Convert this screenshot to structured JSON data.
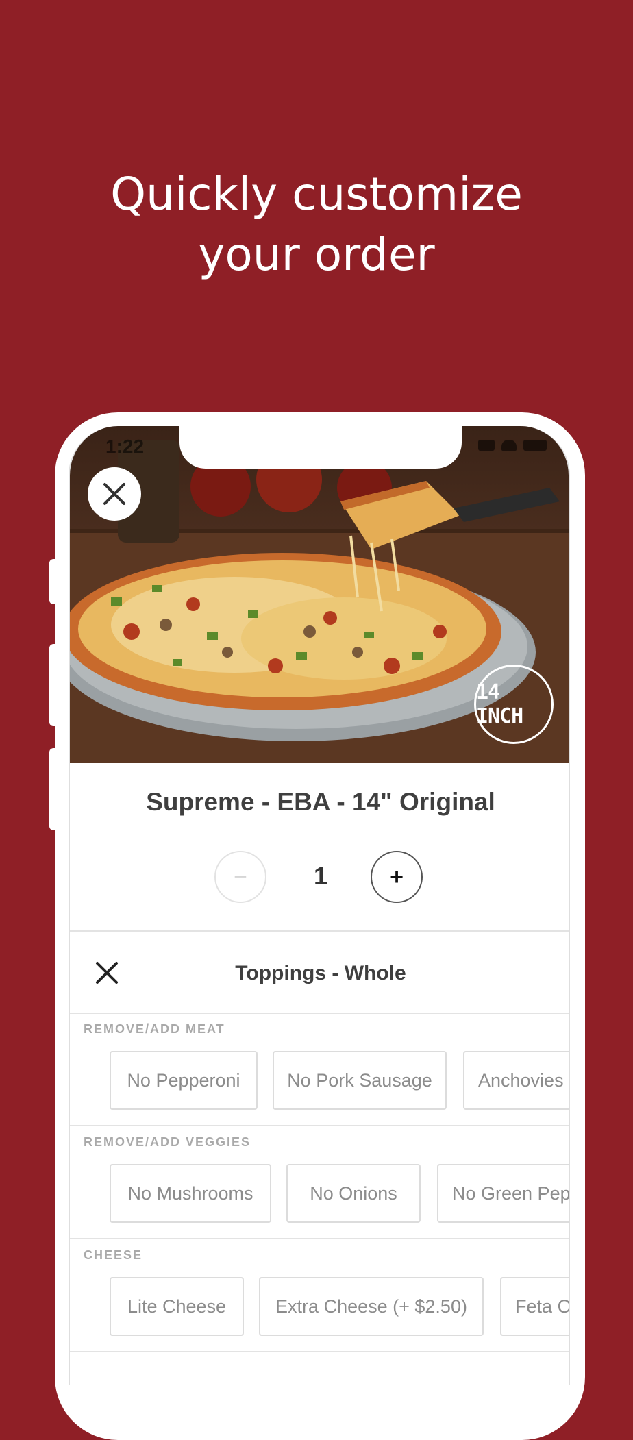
{
  "headline": {
    "line1": "Quickly customize",
    "line2": "your order"
  },
  "status_bar": {
    "time": "1:22"
  },
  "hero": {
    "size_badge": "14 INCH"
  },
  "product": {
    "title": "Supreme - EBA - 14\" Original",
    "quantity": "1",
    "minus_label": "−",
    "plus_label": "+"
  },
  "toppings": {
    "title": "Toppings - Whole",
    "groups": [
      {
        "label": "REMOVE/ADD MEAT",
        "options": [
          "No Pepperoni",
          "No Pork Sausage",
          "Anchovies"
        ]
      },
      {
        "label": "REMOVE/ADD VEGGIES",
        "options": [
          "No Mushrooms",
          "No Onions",
          "No Green Pep"
        ]
      },
      {
        "label": "CHEESE",
        "options": [
          "Lite Cheese",
          "Extra Cheese (+ $2.50)",
          "Feta C"
        ]
      }
    ]
  },
  "colors": {
    "brand_background": "#8f1f26",
    "text_dark": "#3f3f3f",
    "chip_border": "#dcdcdc"
  },
  "icons": [
    "close-icon",
    "minus-icon",
    "plus-icon",
    "navigation-arrow-icon",
    "signal-icon",
    "wifi-icon",
    "battery-icon"
  ]
}
